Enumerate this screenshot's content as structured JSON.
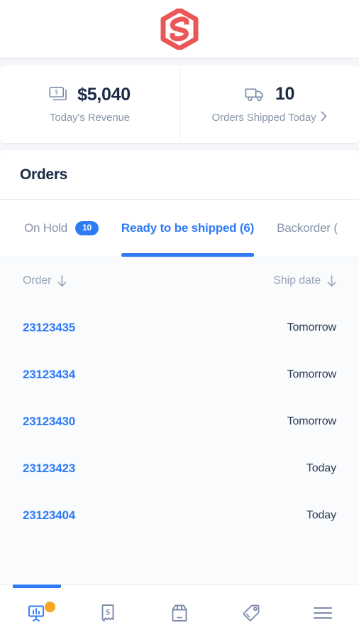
{
  "brand": {
    "logo_icon": "hexagon-s-logo",
    "color": "#eb5757"
  },
  "stats": [
    {
      "icon": "money-bills-icon",
      "value": "$5,040",
      "label": "Today's Revenue",
      "has_chevron": false
    },
    {
      "icon": "delivery-truck-icon",
      "value": "10",
      "label": "Orders Shipped Today",
      "has_chevron": true,
      "chevron_icon": "chevron-right-icon"
    }
  ],
  "orders_panel": {
    "title": "Orders",
    "tabs": [
      {
        "label": "On Hold",
        "badge": "10",
        "active": false
      },
      {
        "label": "Ready to be shipped (6)",
        "badge": "",
        "active": true
      },
      {
        "label": "Backorder (",
        "badge": "",
        "active": false
      }
    ],
    "columns": [
      {
        "label": "Order",
        "sort_icon": "arrow-down-icon"
      },
      {
        "label": "Ship date",
        "sort_icon": "arrow-down-icon"
      }
    ],
    "rows": [
      {
        "order": "23123435",
        "ship_date": "Tomorrow"
      },
      {
        "order": "23123434",
        "ship_date": "Tomorrow"
      },
      {
        "order": "23123430",
        "ship_date": "Tomorrow"
      },
      {
        "order": "23123423",
        "ship_date": "Today"
      },
      {
        "order": "23123404",
        "ship_date": "Today"
      }
    ]
  },
  "bottom_nav": {
    "items": [
      {
        "icon": "presentation-chart-icon",
        "active": true,
        "badge_dot": true
      },
      {
        "icon": "receipt-dollar-icon",
        "active": false,
        "badge_dot": false
      },
      {
        "icon": "package-box-icon",
        "active": false,
        "badge_dot": false
      },
      {
        "icon": "price-tag-icon",
        "active": false,
        "badge_dot": false
      },
      {
        "icon": "hamburger-menu-icon",
        "active": false,
        "badge_dot": false
      }
    ]
  },
  "colors": {
    "accent": "#2f7bf6",
    "brand": "#eb5757",
    "dot": "#f5a623",
    "text_dark": "#1d2b47",
    "text_muted": "#8794ab"
  }
}
